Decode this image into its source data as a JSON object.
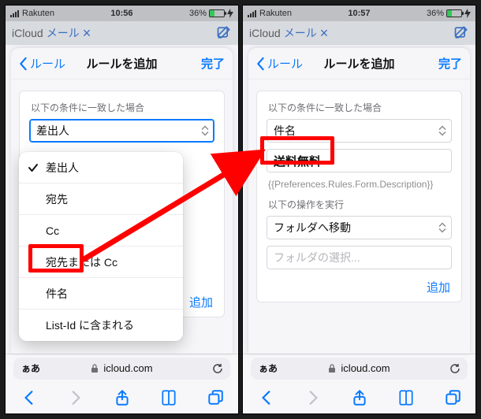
{
  "status_bar": {
    "carrier": "Rakuten",
    "time_left": "10:56",
    "time_right": "10:57",
    "battery_text": "36%"
  },
  "bg_header": {
    "app_title_black": "iCloud",
    "app_title_blue": "メール",
    "close_glyph": "×"
  },
  "sheet": {
    "back_label": "ルール",
    "title": "ルールを追加",
    "done_label": "完了"
  },
  "left": {
    "condition_label": "以下の条件に一致した場合",
    "select_value": "差出人",
    "add_label": "追加",
    "menu_items": [
      "差出人",
      "宛先",
      "Cc",
      "宛先または Cc",
      "件名",
      "List-Id に含まれる"
    ],
    "menu_selected_index": 0
  },
  "right": {
    "condition_label": "以下の条件に一致した場合",
    "condition_select_value": "件名",
    "condition_input_value": "送料無料",
    "description_text": "{{Preferences.Rules.Form.Description}}",
    "action_label": "以下の操作を実行",
    "action_select_value": "フォルダへ移動",
    "action_input_placeholder": "フォルダの選択...",
    "add_label": "追加"
  },
  "addr": {
    "aA": "ぁあ",
    "domain": "icloud.com"
  }
}
